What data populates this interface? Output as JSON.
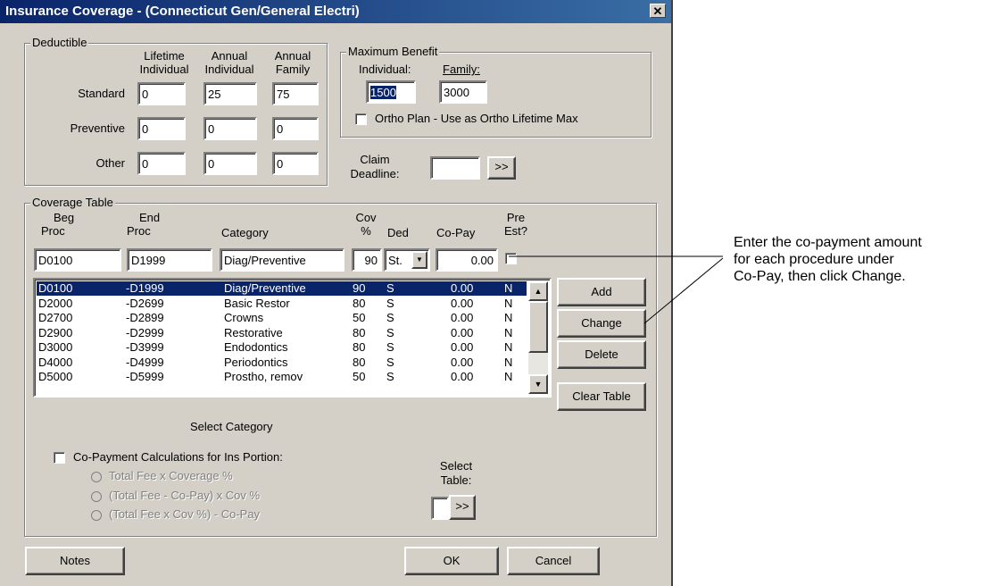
{
  "window": {
    "title": "Insurance Coverage - (Connecticut Gen/General Electri)",
    "close": "✕"
  },
  "deductible": {
    "group_label": "Deductible",
    "col1": [
      "Lifetime",
      "Individual"
    ],
    "col2": [
      "Annual",
      "Individual"
    ],
    "col3": [
      "Annual",
      "Family"
    ],
    "rows": [
      {
        "label": "Standard",
        "values": [
          "0",
          "25",
          "75"
        ]
      },
      {
        "label": "Preventive",
        "values": [
          "0",
          "0",
          "0"
        ]
      },
      {
        "label": "Other",
        "values": [
          "0",
          "0",
          "0"
        ]
      }
    ]
  },
  "max_benefit": {
    "group_label": "Maximum Benefit",
    "individual_label": "Individual:",
    "family_label": "Family:",
    "individual_value": "1500",
    "family_value": "3000",
    "ortho_label": "Ortho Plan - Use as Ortho Lifetime Max"
  },
  "claim": {
    "label1": "Claim",
    "label2": "Deadline:",
    "value": "",
    "btn": ">>"
  },
  "coverage": {
    "group_label": "Coverage Table",
    "headers": {
      "beg1": "Beg",
      "beg2": "Proc",
      "end1": "End",
      "end2": "Proc",
      "category": "Category",
      "cov1": "Cov",
      "cov2": "%",
      "ded": "Ded",
      "copay": "Co-Pay",
      "pre1": "Pre",
      "pre2": "Est?"
    },
    "edit": {
      "beg": "D0100",
      "end": "D1999",
      "category": "Diag/Preventive",
      "cov": "90",
      "ded": "St.",
      "copay": "0.00"
    },
    "rows": [
      {
        "beg": "D0100",
        "end": "-D1999",
        "category": "Diag/Preventive",
        "cov": "90",
        "ded": "S",
        "copay": "0.00",
        "pre": "N"
      },
      {
        "beg": "D2000",
        "end": "-D2699",
        "category": "Basic Restor",
        "cov": "80",
        "ded": "S",
        "copay": "0.00",
        "pre": "N"
      },
      {
        "beg": "D2700",
        "end": "-D2899",
        "category": "Crowns",
        "cov": "50",
        "ded": "S",
        "copay": "0.00",
        "pre": "N"
      },
      {
        "beg": "D2900",
        "end": "-D2999",
        "category": "Restorative",
        "cov": "80",
        "ded": "S",
        "copay": "0.00",
        "pre": "N"
      },
      {
        "beg": "D3000",
        "end": "-D3999",
        "category": "Endodontics",
        "cov": "80",
        "ded": "S",
        "copay": "0.00",
        "pre": "N"
      },
      {
        "beg": "D4000",
        "end": "-D4999",
        "category": "Periodontics",
        "cov": "80",
        "ded": "S",
        "copay": "0.00",
        "pre": "N"
      },
      {
        "beg": "D5000",
        "end": "-D5999",
        "category": "Prostho, remov",
        "cov": "50",
        "ded": "S",
        "copay": "0.00",
        "pre": "N"
      }
    ],
    "buttons": {
      "add": "Add",
      "change": "Change",
      "delete": "Delete",
      "clear": "Clear Table"
    },
    "select_category": "Select Category",
    "copay_calc_label": "Co-Payment Calculations for Ins Portion:",
    "radios": [
      "Total Fee  x  Coverage %",
      "(Total Fee - Co-Pay) x Cov %",
      "(Total Fee x Cov %) - Co-Pay"
    ],
    "select_table1": "Select",
    "select_table2": "Table:",
    "select_table_btn": ">>"
  },
  "footer": {
    "notes": "Notes",
    "ok": "OK",
    "cancel": "Cancel"
  },
  "callout": {
    "line1": "Enter the co-payment amount",
    "line2": "for each procedure under",
    "line3": "Co-Pay, then click Change."
  }
}
